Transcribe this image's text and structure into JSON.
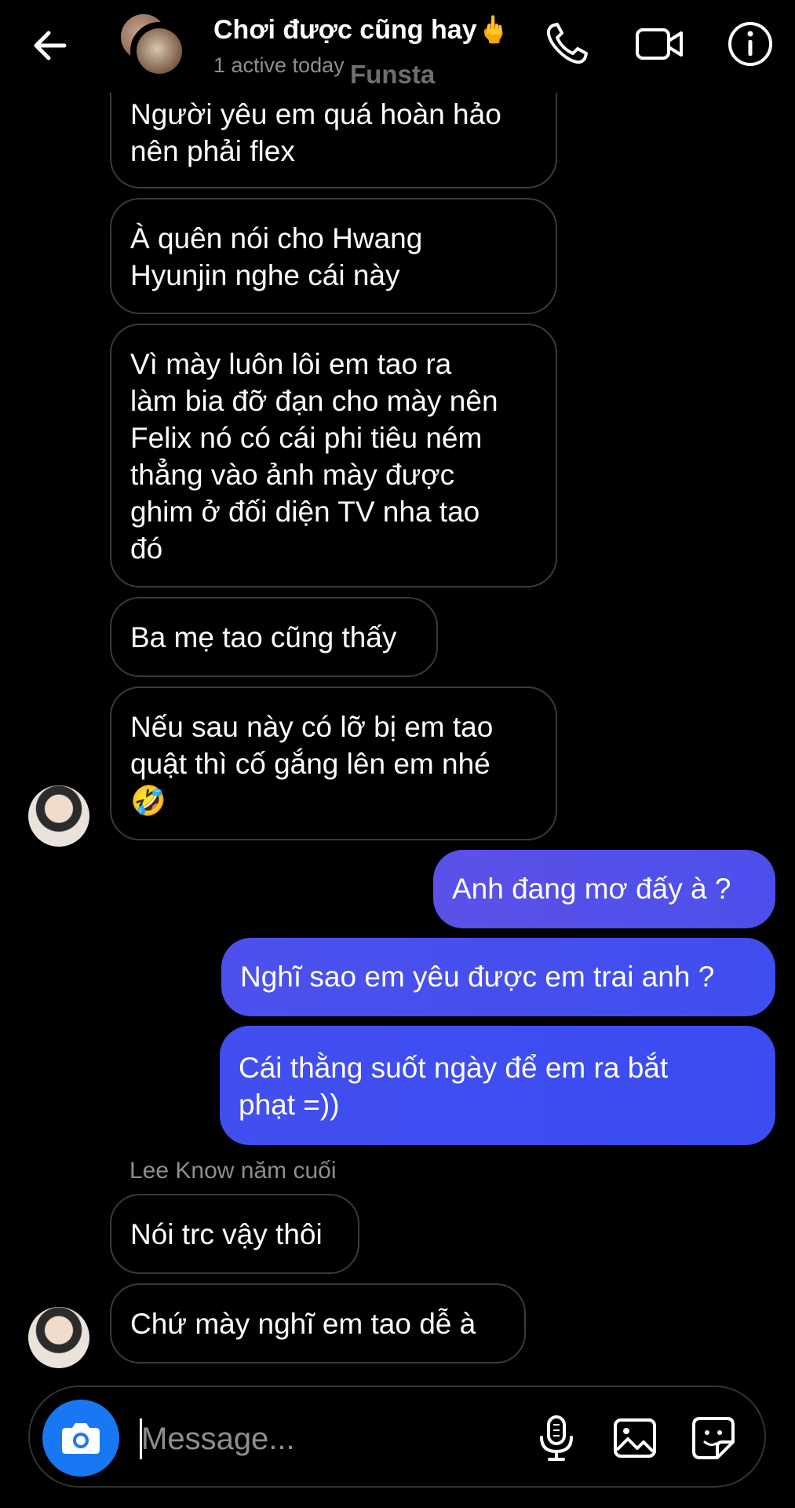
{
  "header": {
    "title": "Chơi được cũng hay🖕",
    "subtitle": "1 active today",
    "watermark": "Funsta",
    "icons": [
      "back-arrow-icon",
      "phone-icon",
      "video-icon",
      "info-icon"
    ]
  },
  "messages": {
    "m1": [
      "Người yêu em quá hoàn hảo",
      "nên phải flex"
    ],
    "m2": [
      "À quên nói cho Hwang",
      "Hyunjin nghe cái này"
    ],
    "m3": [
      "Vì mày luôn lôi em tao ra",
      "làm bia đỡ đạn cho mày nên",
      "Felix nó có cái phi tiêu ném",
      "thẳng vào ảnh mày được",
      "ghim ở đối diện TV nha tao",
      "đó"
    ],
    "m4": [
      "Ba mẹ tao cũng thấy"
    ],
    "m5": [
      "Nếu sau này có lỡ bị em tao",
      "quật thì cố gắng lên em nhé",
      "🤣"
    ],
    "s1": [
      "Anh đang mơ đấy à ?"
    ],
    "s2": [
      "Nghĩ sao em yêu được em trai anh ?"
    ],
    "s3": [
      "Cái thằng suốt ngày để em ra bắt",
      "phạt =))"
    ],
    "sender_name": "Lee Know năm cuối",
    "m6": [
      "Nói trc vậy thôi"
    ],
    "m7": [
      "Chứ mày nghĩ em tao dễ à"
    ]
  },
  "composer": {
    "placeholder": "Message...",
    "icons": [
      "camera-icon",
      "microphone-icon",
      "gallery-icon",
      "sticker-icon"
    ]
  },
  "colors": {
    "background": "#000000",
    "sent_gradient_start": "#5b51e8",
    "sent_gradient_end": "#3e4ef0",
    "camera_button": "#1877f2"
  }
}
